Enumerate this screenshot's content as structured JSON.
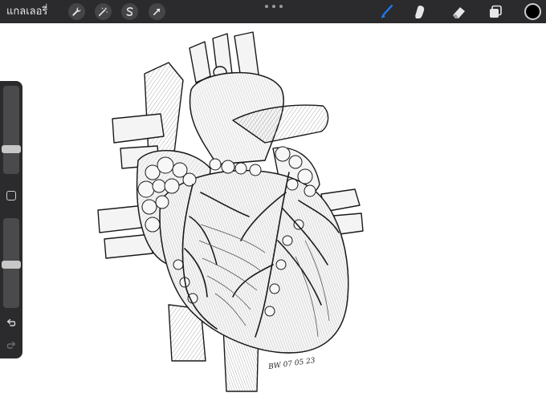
{
  "toolbar": {
    "gallery_label": "แกลเลอรี่",
    "actions": [
      {
        "name": "wrench-icon"
      },
      {
        "name": "magic-wand-icon"
      },
      {
        "name": "selection-s-icon"
      },
      {
        "name": "transform-arrow-icon"
      }
    ],
    "more_menu": "more-dots-icon",
    "tools": [
      {
        "name": "brush-icon",
        "active": true,
        "color": "#1e7bff"
      },
      {
        "name": "smudge-icon",
        "active": false,
        "color": "#e6e6e6"
      },
      {
        "name": "eraser-icon",
        "active": false,
        "color": "#e6e6e6"
      },
      {
        "name": "layers-icon",
        "active": false,
        "color": "#e6e6e6"
      }
    ],
    "current_color": "#000000"
  },
  "sidebar": {
    "brush_size_level": 0.28,
    "opacity_level": 0.48,
    "undo_icon": "undo-arrow-icon",
    "redo_icon": "redo-arrow-icon"
  },
  "canvas": {
    "subject": "anatomical-heart-drawing",
    "signature_text": "BW 07 05 23"
  }
}
